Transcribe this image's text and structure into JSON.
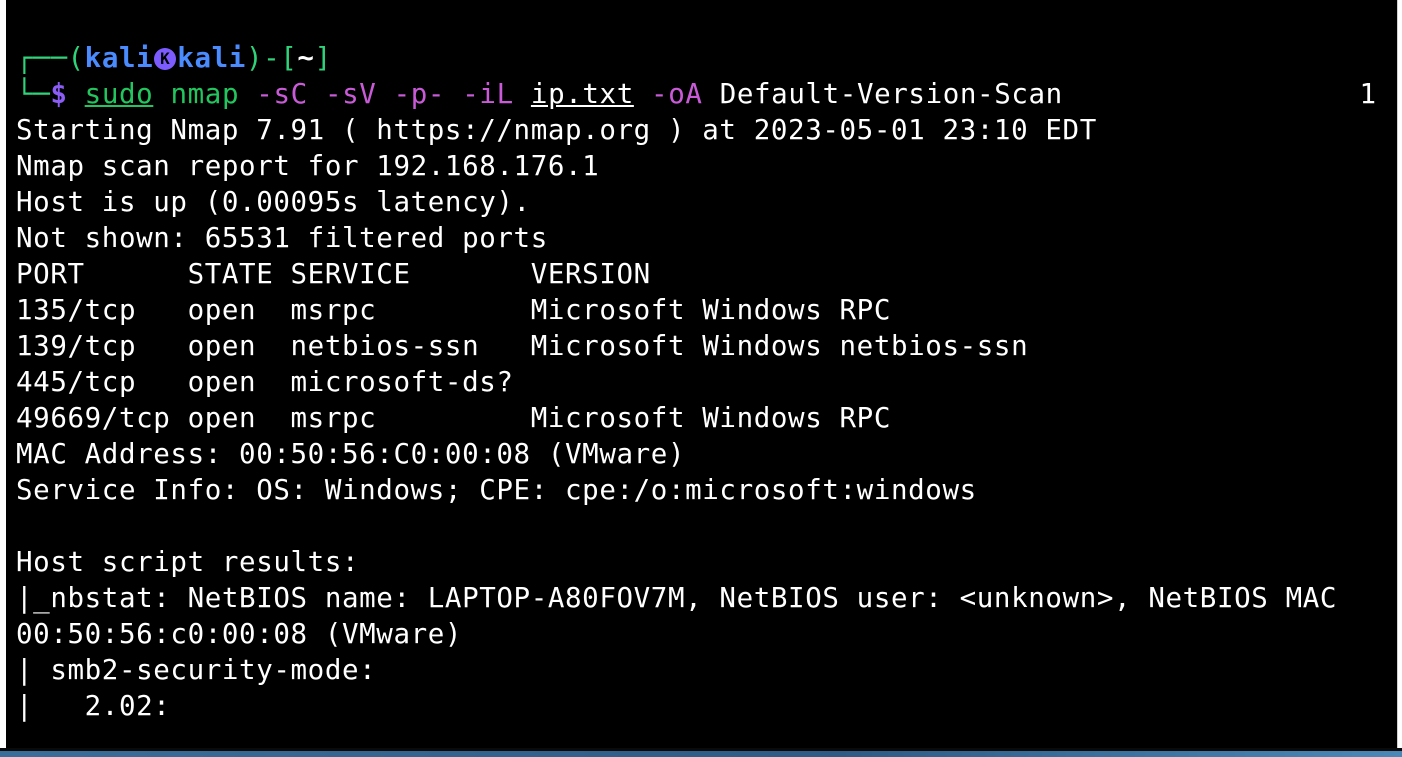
{
  "prompt": {
    "corner_top": "┌──",
    "open_paren": "(",
    "user": "kali",
    "host_sep_icon": "K",
    "host": "kali",
    "close_bracket_open": ")-[",
    "cwd": "~",
    "close_bracket": "]",
    "corner_bottom": "└─",
    "dollar": "$",
    "cmd_sudo": "sudo",
    "cmd_nmap": "nmap",
    "opt_sc": "-sC",
    "opt_sv": "-sV",
    "opt_p": "-p-",
    "opt_il": "-iL",
    "arg_file": "ip.txt",
    "opt_oa": "-oA",
    "arg_out": "Default-Version-Scan",
    "tab_number": "1"
  },
  "output": {
    "lines": [
      "Starting Nmap 7.91 ( https://nmap.org ) at 2023-05-01 23:10 EDT",
      "Nmap scan report for 192.168.176.1",
      "Host is up (0.00095s latency).",
      "Not shown: 65531 filtered ports",
      "PORT      STATE SERVICE       VERSION",
      "135/tcp   open  msrpc         Microsoft Windows RPC",
      "139/tcp   open  netbios-ssn   Microsoft Windows netbios-ssn",
      "445/tcp   open  microsoft-ds?",
      "49669/tcp open  msrpc         Microsoft Windows RPC",
      "MAC Address: 00:50:56:C0:00:08 (VMware)",
      "Service Info: OS: Windows; CPE: cpe:/o:microsoft:windows",
      "",
      "Host script results:",
      "|_nbstat: NetBIOS name: LAPTOP-A80FOV7M, NetBIOS user: <unknown>, NetBIOS MAC",
      "00:50:56:c0:00:08 (VMware)",
      "| smb2-security-mode:",
      "|   2.02:"
    ]
  },
  "colors": {
    "background": "#000000",
    "text": "#ffffff",
    "prompt_green": "#2fd37a",
    "prompt_blue": "#4a8cff",
    "command_green": "#23c55e",
    "option_magenta": "#c95bd8"
  }
}
